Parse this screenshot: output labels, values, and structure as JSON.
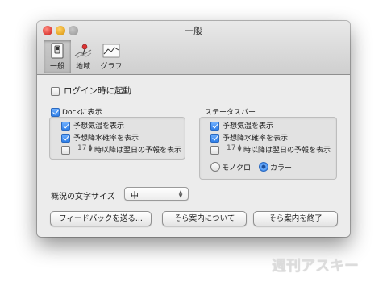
{
  "window": {
    "title": "一般"
  },
  "toolbar": {
    "items": [
      {
        "label": "一般",
        "icon": "switch-icon",
        "active": true
      },
      {
        "label": "地域",
        "icon": "map-pin-icon",
        "active": false
      },
      {
        "label": "グラフ",
        "icon": "graph-icon",
        "active": false
      }
    ]
  },
  "launch_at_login": {
    "label": "ログイン時に起動",
    "checked": false
  },
  "dock": {
    "label": "Dockに表示",
    "checked": true,
    "options": {
      "show_temp": {
        "label": "予想気温を表示",
        "checked": true
      },
      "show_rain": {
        "label": "予想降水確率を表示",
        "checked": true
      },
      "next_day": {
        "hour": "17",
        "label": "時以降は翌日の予報を表示",
        "checked": false
      }
    }
  },
  "statusbar": {
    "label": "ステータスバー",
    "options": {
      "show_temp": {
        "label": "予想気温を表示",
        "checked": true
      },
      "show_rain": {
        "label": "予想降水確率を表示",
        "checked": true
      },
      "next_day": {
        "hour": "17",
        "label": "時以降は翌日の予報を表示",
        "checked": false
      }
    },
    "color_mode": {
      "mono_label": "モノクロ",
      "color_label": "カラー",
      "selected": "color"
    }
  },
  "font_size": {
    "label": "概況の文字サイズ",
    "value": "中"
  },
  "buttons": {
    "feedback": "フィードバックを送る...",
    "about": "そら案内について",
    "quit": "そら案内を終了"
  },
  "watermark": "週刊アスキー"
}
